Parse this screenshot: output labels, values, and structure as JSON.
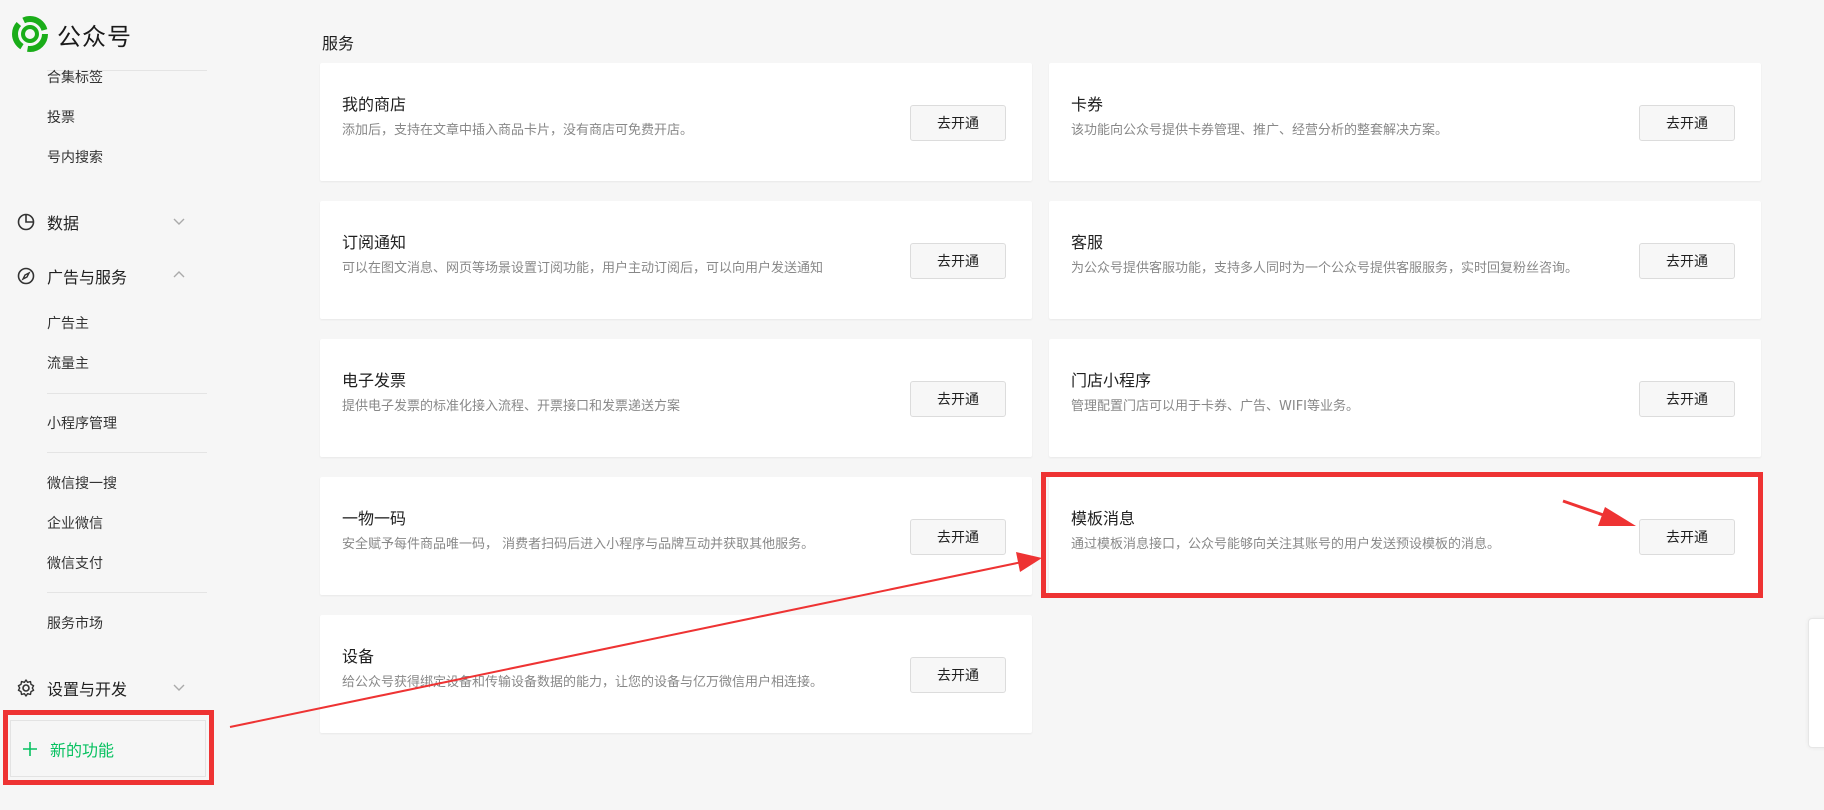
{
  "brand": {
    "name": "公众号"
  },
  "sidebar": {
    "top_items": [
      "合集标签",
      "投票",
      "号内搜索"
    ],
    "sections": {
      "data": {
        "label": "数据",
        "icon": "pie-chart-icon",
        "expanded": false
      },
      "ads": {
        "label": "广告与服务",
        "icon": "compass-icon",
        "expanded": true
      },
      "settings": {
        "label": "设置与开发",
        "icon": "gear-icon",
        "expanded": false
      }
    },
    "ads_items": [
      "广告主",
      "流量主",
      "小程序管理",
      "微信搜一搜",
      "企业微信",
      "微信支付",
      "服务市场"
    ],
    "new_feature": {
      "label": "新的功能",
      "icon": "plus-icon"
    }
  },
  "main": {
    "title": "服务",
    "cards": [
      {
        "title": "我的商店",
        "desc": "添加后，支持在文章中插入商品卡片，没有商店可免费开店。",
        "button": "去开通"
      },
      {
        "title": "卡券",
        "desc": "该功能向公众号提供卡券管理、推广、经营分析的整套解决方案。",
        "button": "去开通"
      },
      {
        "title": "订阅通知",
        "desc": "可以在图文消息、网页等场景设置订阅功能，用户主动订阅后，可以向用户发送通知",
        "button": "去开通"
      },
      {
        "title": "客服",
        "desc": "为公众号提供客服功能，支持多人同时为一个公众号提供客服服务，实时回复粉丝咨询。",
        "button": "去开通"
      },
      {
        "title": "电子发票",
        "desc": "提供电子发票的标准化接入流程、开票接口和发票递送方案",
        "button": "去开通"
      },
      {
        "title": "门店小程序",
        "desc": "管理配置门店可以用于卡券、广告、WIFI等业务。",
        "button": "去开通"
      },
      {
        "title": "一物一码",
        "desc": "安全赋予每件商品唯一码， 消费者扫码后进入小程序与品牌互动并获取其他服务。",
        "button": "去开通"
      },
      {
        "title": "模板消息",
        "desc": "通过模板消息接口，公众号能够向关注其账号的用户发送预设模板的消息。",
        "button": "去开通"
      },
      {
        "title": "设备",
        "desc": "给公众号获得绑定设备和传输设备数据的能力，让您的设备与亿万微信用户相连接。",
        "button": "去开通"
      }
    ]
  },
  "colors": {
    "accent": "#07c160",
    "annotation": "#ee3333"
  }
}
